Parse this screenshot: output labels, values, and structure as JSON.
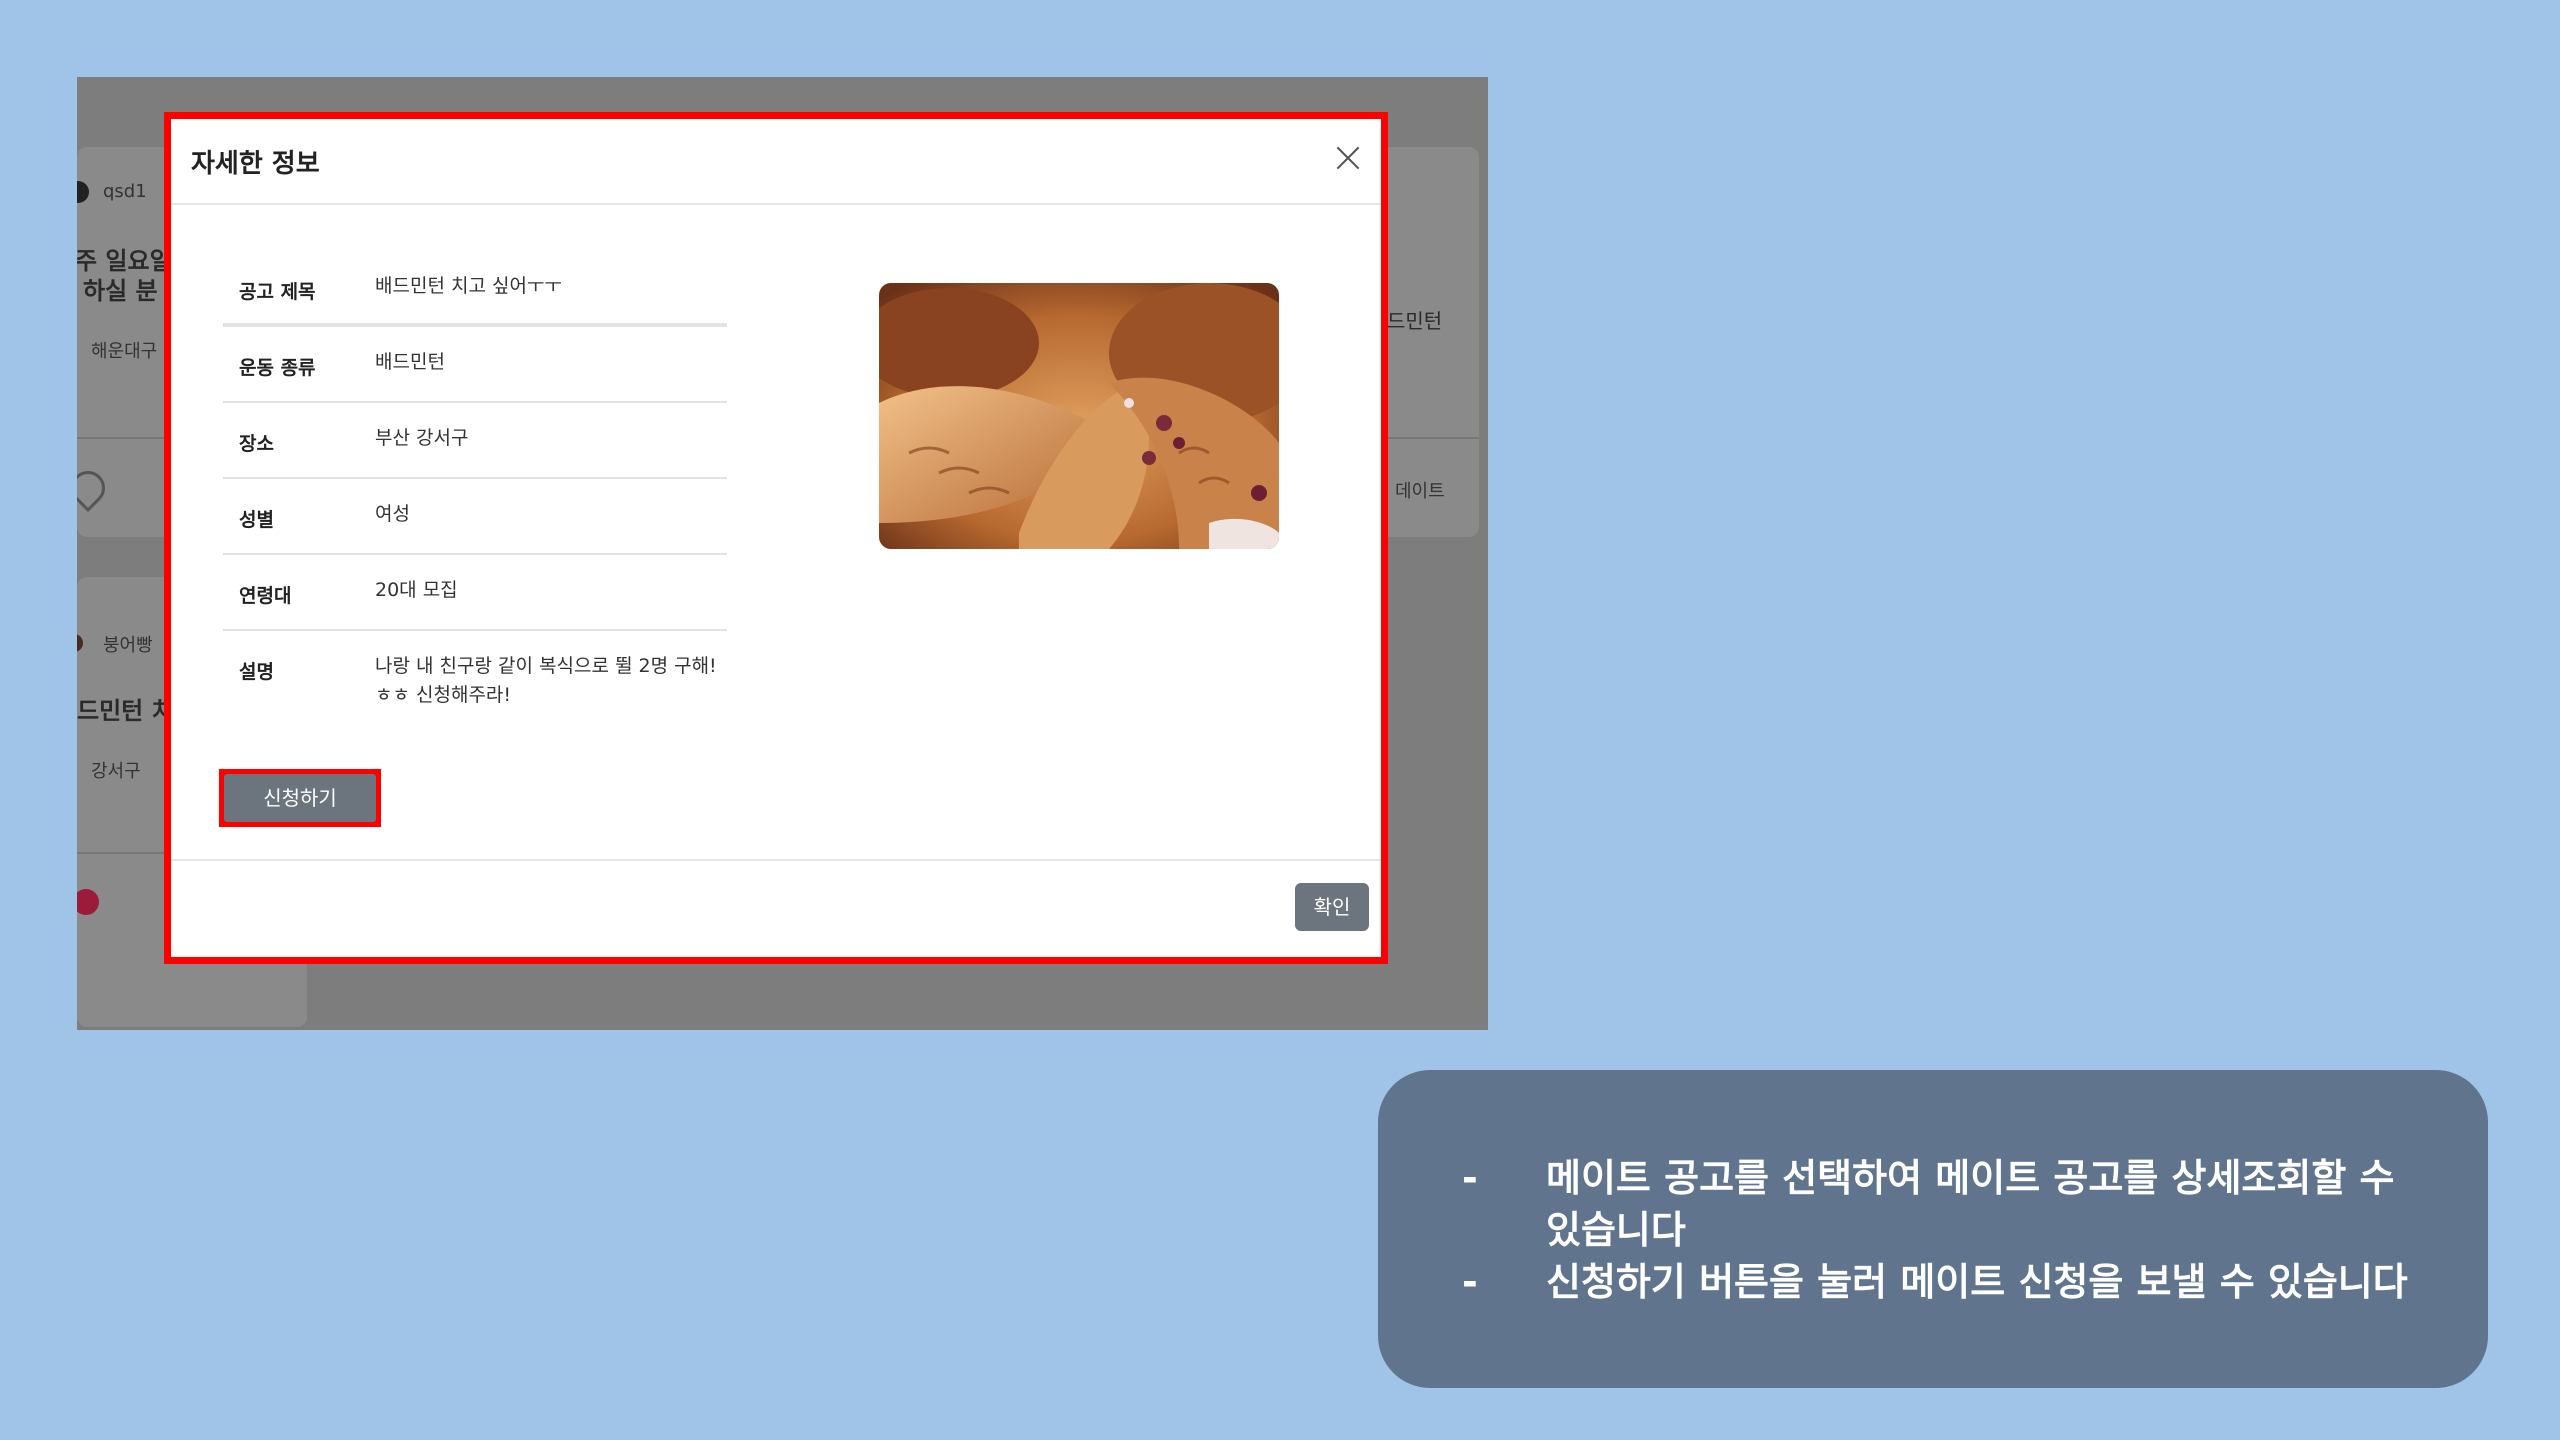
{
  "background_page": {
    "cards": [
      {
        "user": "qsd1",
        "title_fragment_1": "주 일요일",
        "title_fragment_2": "하실 분",
        "location_fragment": "해운대구"
      },
      {
        "user": "붕어빵",
        "title_fragment": "드민턴 치",
        "location_fragment": "강서구"
      }
    ],
    "right_fragments": [
      "드민턴",
      "데이트"
    ]
  },
  "modal": {
    "title": "자세한 정보",
    "rows": [
      {
        "label": "공고 제목",
        "value": "배드민턴 치고 싶어ㅜㅜ"
      },
      {
        "label": "운동 종류",
        "value": "배드민턴"
      },
      {
        "label": "장소",
        "value": "부산 강서구"
      },
      {
        "label": "성별",
        "value": "여성"
      },
      {
        "label": "연령대",
        "value": "20대 모집"
      },
      {
        "label": "설명",
        "value": "나랑 내 친구랑 같이 복식으로 뛸 2명 구해!ㅎㅎ 신청해주라!"
      }
    ],
    "apply_label": "신청하기",
    "confirm_label": "확인"
  },
  "caption": {
    "bullets": [
      {
        "dash": "-",
        "text": "메이트 공고를 선택하여 메이트 공고를 상세조회할 수 있습니다"
      },
      {
        "dash": "-",
        "text": "신청하기 버튼을 눌러 메이트 신청을 보낼 수 있습니다"
      }
    ]
  },
  "colors": {
    "page_background": "#9fc4e8",
    "highlight": "#ff0000",
    "button": "#6c757d",
    "caption_box": "#60758d"
  }
}
